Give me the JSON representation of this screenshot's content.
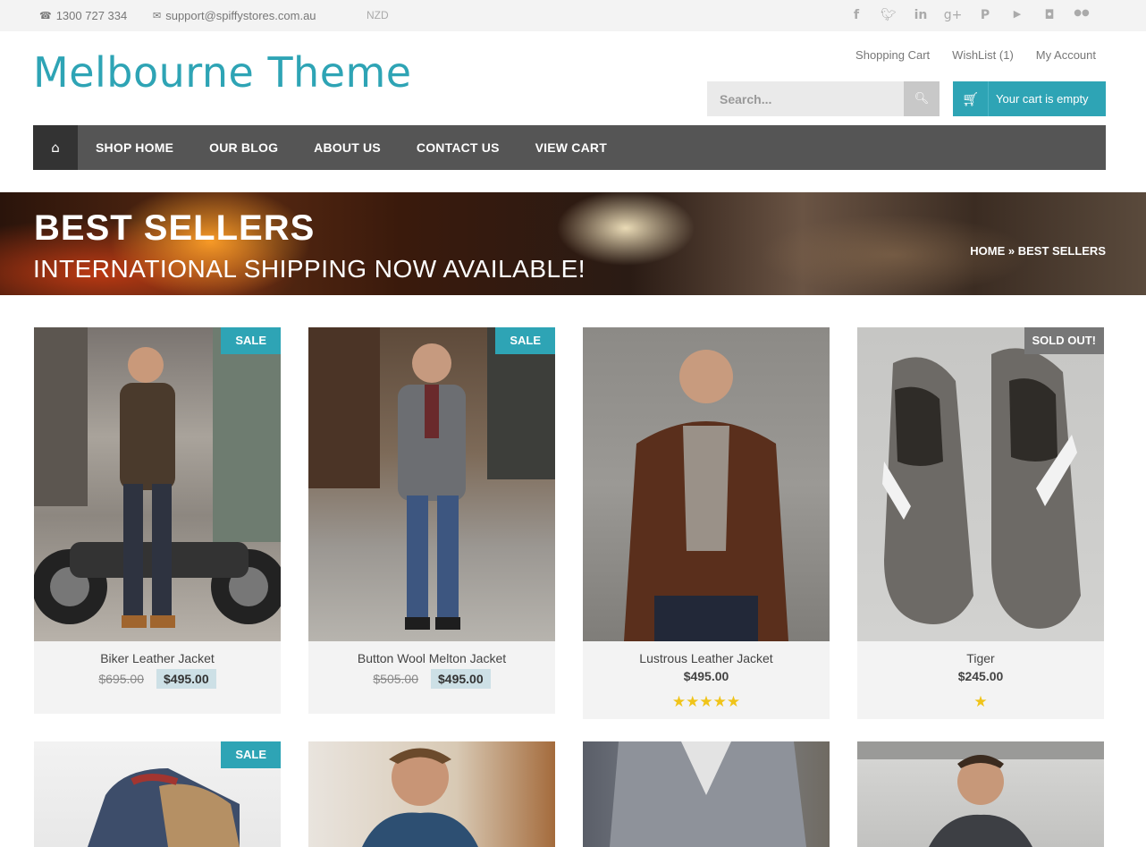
{
  "topbar": {
    "phone": "1300 727 334",
    "email": "support@spiffystores.com.au",
    "currency": "NZD",
    "social_icons": [
      "facebook-icon",
      "twitter-icon",
      "linkedin-icon",
      "google-plus-icon",
      "pinterest-icon",
      "youtube-icon",
      "instagram-icon",
      "flickr-icon"
    ]
  },
  "header": {
    "logo": "Melbourne Theme",
    "links": [
      "Shopping Cart",
      "WishList (1)",
      "My Account"
    ],
    "search_placeholder": "Search...",
    "cart_label": "Your cart is empty"
  },
  "nav": {
    "items": [
      "SHOP HOME",
      "OUR BLOG",
      "ABOUT US",
      "CONTACT US",
      "VIEW CART"
    ]
  },
  "banner": {
    "title": "BEST SELLERS",
    "subtitle": "INTERNATIONAL SHIPPING NOW AVAILABLE!",
    "breadcrumb": "HOME » BEST SELLERS"
  },
  "products": [
    {
      "name": "Biker Leather Jacket",
      "badge": "SALE",
      "old_price": "$695.00",
      "price": "$495.00",
      "rating": 0
    },
    {
      "name": "Button Wool Melton Jacket",
      "badge": "SALE",
      "old_price": "$505.00",
      "price": "$495.00",
      "rating": 0
    },
    {
      "name": "Lustrous Leather Jacket",
      "badge": "",
      "old_price": "",
      "price": "$495.00",
      "rating": 5
    },
    {
      "name": "Tiger",
      "badge": "SOLD OUT!",
      "old_price": "",
      "price": "$245.00",
      "rating": 1
    },
    {
      "name": "",
      "badge": "SALE",
      "old_price": "",
      "price": "",
      "rating": 0
    },
    {
      "name": "",
      "badge": "",
      "old_price": "",
      "price": "",
      "rating": 0
    },
    {
      "name": "",
      "badge": "",
      "old_price": "",
      "price": "",
      "rating": 0
    },
    {
      "name": "",
      "badge": "",
      "old_price": "",
      "price": "",
      "rating": 0
    }
  ],
  "colors": {
    "accent": "#2ea4b5",
    "nav": "#555555",
    "nav_home": "#333333",
    "sale_price_bg": "#cde0e6",
    "star": "#f0c419"
  }
}
